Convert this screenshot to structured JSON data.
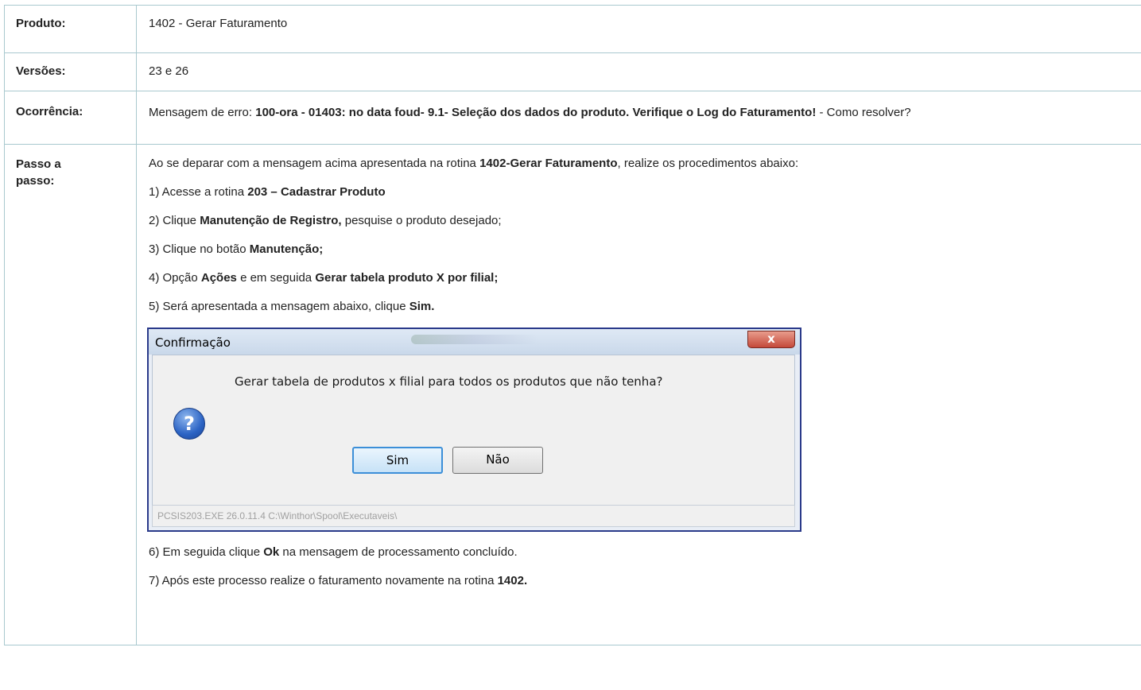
{
  "rows": {
    "produto": {
      "label": "Produto:",
      "value": "1402 - Gerar Faturamento"
    },
    "versoes": {
      "label": "Versões:",
      "value": "23 e 26"
    },
    "ocorrencia": {
      "label": "Ocorrência:",
      "prefix": "Mensagem de erro: ",
      "bold": "100-ora - 01403: no data foud- 9.1- Seleção dos dados do produto. Verifique o Log do Faturamento!",
      "suffix": " - Como resolver?"
    },
    "passo": {
      "label_line1": "Passo a",
      "label_line2": "passo:"
    }
  },
  "steps": {
    "intro": {
      "a": "Ao se deparar com a mensagem acima apresentada na rotina ",
      "b": "1402-Gerar Faturamento",
      "c": ", realize os procedimentos abaixo:"
    },
    "s1": {
      "a": "1) Acesse a rotina ",
      "b": "203 – Cadastrar Produto"
    },
    "s2": {
      "a": "2) Clique ",
      "b": "Manutenção de Registro,",
      "c": " pesquise o produto desejado;"
    },
    "s3": {
      "a": "3) Clique no botão ",
      "b": "Manutenção;"
    },
    "s4": {
      "a": "4) Opção ",
      "b": "Ações",
      "c": " e em seguida ",
      "d": "Gerar tabela  produto X por filial;"
    },
    "s5": {
      "a": "5) Será apresentada a mensagem abaixo, clique ",
      "b": "Sim."
    },
    "s6": {
      "a": "6) Em seguida clique ",
      "b": "Ok",
      "c": " na mensagem de processamento concluído."
    },
    "s7": {
      "a": "7) Após este processo realize o faturamento novamente na rotina ",
      "b": "1402."
    }
  },
  "dialog": {
    "title": "Confirmação",
    "close_glyph": "x",
    "icon": "question-icon",
    "icon_glyph": "?",
    "message": "Gerar tabela de produtos x filial para todos os produtos que não tenha?",
    "yes_label": "Sim",
    "no_label": "Não",
    "status": "PCSIS203.EXE 26.0.11.4 C:\\Winthor\\Spool\\Executaveis\\"
  }
}
